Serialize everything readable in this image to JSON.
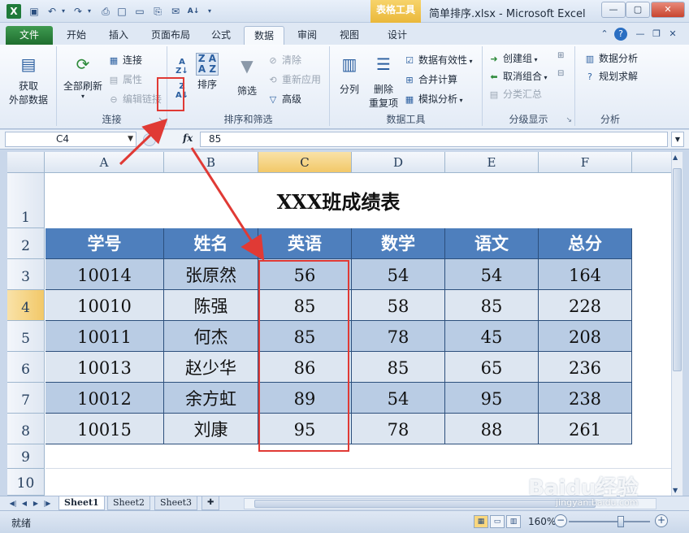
{
  "window": {
    "title": "简单排序.xlsx - Microsoft Excel",
    "context_tab_group": "表格工具",
    "close_label": "✕",
    "min_label": "—",
    "max_label": "▢"
  },
  "ribbon_tabs": [
    {
      "label": "文件"
    },
    {
      "label": "开始"
    },
    {
      "label": "插入"
    },
    {
      "label": "页面布局"
    },
    {
      "label": "公式"
    },
    {
      "label": "数据"
    },
    {
      "label": "审阅"
    },
    {
      "label": "视图"
    },
    {
      "label": "设计"
    }
  ],
  "ribbon": {
    "get_external": {
      "label1": "获取",
      "label2": "外部数据"
    },
    "connections": {
      "refresh_all": "全部刷新",
      "connections": "连接",
      "properties": "属性",
      "edit_links": "编辑链接",
      "group_label": "连接"
    },
    "sort_filter": {
      "sort": "排序",
      "filter": "筛选",
      "clear": "清除",
      "reapply": "重新应用",
      "advanced": "高级",
      "group_label": "排序和筛选"
    },
    "data_tools": {
      "text_to_columns": "分列",
      "remove_dup1": "删除",
      "remove_dup2": "重复项",
      "data_validation": "数据有效性",
      "consolidate": "合并计算",
      "what_if": "模拟分析",
      "group_label": "数据工具"
    },
    "outline": {
      "group": "创建组",
      "ungroup": "取消组合",
      "subtotal": "分类汇总",
      "group_label": "分级显示"
    },
    "analysis": {
      "data_analysis": "数据分析",
      "solver": "规划求解",
      "group_label": "分析"
    }
  },
  "formula_bar": {
    "name_box": "C4",
    "fx": "fx",
    "value": "85"
  },
  "columns": [
    "A",
    "B",
    "C",
    "D",
    "E",
    "F"
  ],
  "rows": [
    "1",
    "2",
    "3",
    "4",
    "5",
    "6",
    "7",
    "8",
    "9",
    "10"
  ],
  "sheet": {
    "title": "XXX班成绩表",
    "headers": [
      "学号",
      "姓名",
      "英语",
      "数学",
      "语文",
      "总分"
    ],
    "records": [
      [
        "10014",
        "张原然",
        "56",
        "54",
        "54",
        "164"
      ],
      [
        "10010",
        "陈强",
        "85",
        "58",
        "85",
        "228"
      ],
      [
        "10011",
        "何杰",
        "85",
        "78",
        "45",
        "208"
      ],
      [
        "10013",
        "赵少华",
        "86",
        "85",
        "65",
        "236"
      ],
      [
        "10012",
        "余方虹",
        "89",
        "54",
        "95",
        "238"
      ],
      [
        "10015",
        "刘康",
        "95",
        "78",
        "88",
        "261"
      ]
    ]
  },
  "sheet_tabs": [
    "Sheet1",
    "Sheet2",
    "Sheet3"
  ],
  "status": {
    "ready": "就绪",
    "zoom": "160%"
  },
  "watermark": {
    "brand": "Baidu经验",
    "url": "jingyan.baidu.com"
  },
  "colors": {
    "header_fill": "#4e7fbd",
    "row_band_dark": "#b9cce4",
    "row_band_light": "#dde6f1",
    "annotation_red": "#e03a35",
    "file_tab": "#1f6e2f",
    "context_tab": "#eab83a"
  }
}
